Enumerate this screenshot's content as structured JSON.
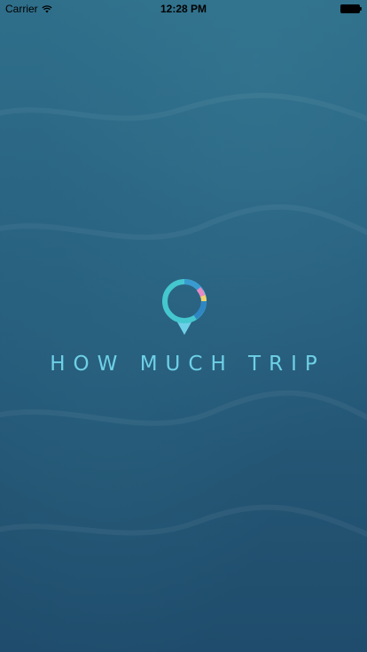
{
  "status_bar": {
    "carrier": "Carrier",
    "time": "12:28 PM"
  },
  "app": {
    "brand_name": "HOW MUCH TRIP"
  },
  "icons": {
    "wifi": "wifi-icon",
    "battery": "battery-icon",
    "logo": "location-pin-logo"
  },
  "colors": {
    "background_top": "#2f6f8a",
    "background_bottom": "#1f4c6c",
    "brand_text": "#6ed0e6",
    "logo_teal": "#45c7cf",
    "logo_blue": "#3a9bd1",
    "logo_pink": "#e58bc4",
    "logo_yellow": "#f2d36b"
  }
}
